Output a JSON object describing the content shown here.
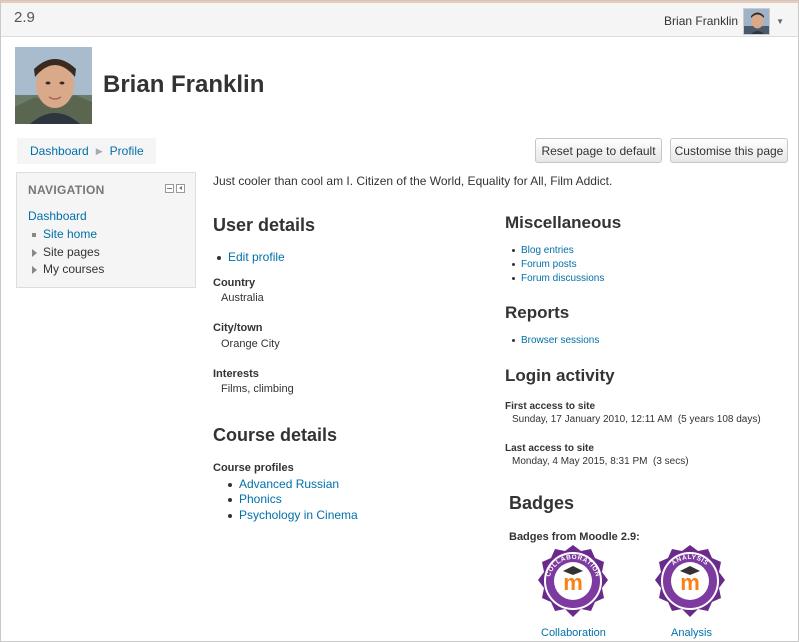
{
  "navbar": {
    "version": "2.9",
    "user_name": "Brian Franklin"
  },
  "header": {
    "title": "Brian Franklin"
  },
  "breadcrumb": {
    "items": [
      "Dashboard",
      "Profile"
    ]
  },
  "buttons": {
    "reset": "Reset page to default",
    "customise": "Customise this page"
  },
  "navigation": {
    "title": "NAVIGATION",
    "dashboard": "Dashboard",
    "site_home": "Site home",
    "site_pages": "Site pages",
    "my_courses": "My courses"
  },
  "description": "Just cooler than cool am I. Citizen of the World, Equality for All, Film Addict.",
  "user_details": {
    "title": "User details",
    "edit_profile": "Edit profile",
    "country_label": "Country",
    "country_value": "Australia",
    "city_label": "City/town",
    "city_value": "Orange City",
    "interests_label": "Interests",
    "interests_value": "Films, climbing"
  },
  "course_details": {
    "title": "Course details",
    "profiles_label": "Course profiles",
    "courses": [
      "Advanced Russian",
      "Phonics",
      "Psychology in Cinema"
    ]
  },
  "miscellaneous": {
    "title": "Miscellaneous",
    "items": [
      "Blog entries",
      "Forum posts",
      "Forum discussions"
    ]
  },
  "reports": {
    "title": "Reports",
    "items": [
      "Browser sessions"
    ]
  },
  "login_activity": {
    "title": "Login activity",
    "first_label": "First access to site",
    "first_value": "Sunday, 17 January 2010, 12:11 AM  (5 years 108 days)",
    "last_label": "Last access to site",
    "last_value": "Monday, 4 May 2015, 8:31 PM  (3 secs)"
  },
  "badges": {
    "title": "Badges",
    "from_label": "Badges from Moodle 2.9:",
    "items": [
      {
        "ring_text": "COLLABORATION",
        "label": "Collaboration"
      },
      {
        "ring_text": "ANALYSIS",
        "label": "Analysis"
      }
    ]
  },
  "colors": {
    "link": "#0070a8",
    "badge_purple": "#6a2a8c",
    "moodle_orange": "#f98012"
  }
}
